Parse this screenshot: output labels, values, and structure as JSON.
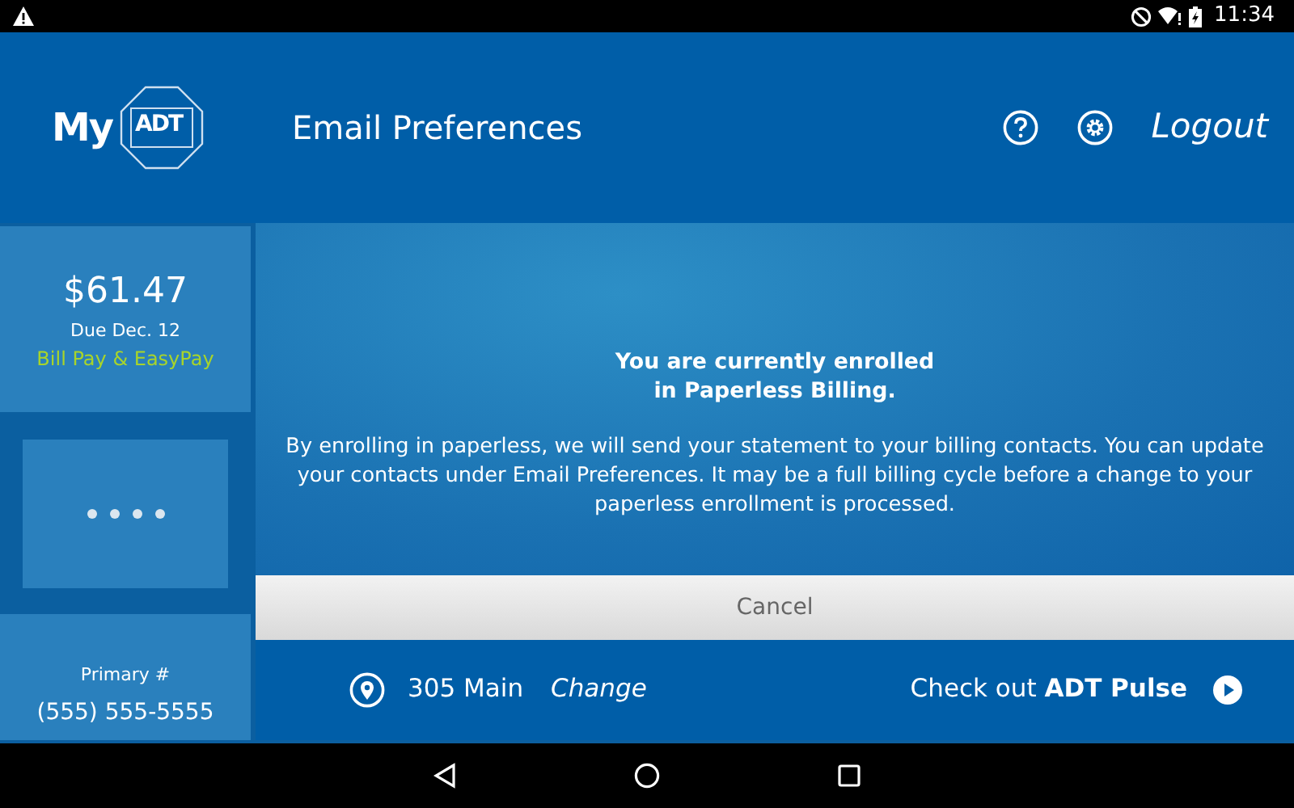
{
  "status_bar": {
    "time": "11:34"
  },
  "header": {
    "logo_prefix": "My",
    "logo_mark": "ADT",
    "title": "Email Preferences",
    "logout": "Logout"
  },
  "sidebar": {
    "bill": {
      "amount": "$61.47",
      "due": "Due Dec. 12",
      "link": "Bill Pay & EasyPay"
    },
    "contact": {
      "label": "Primary #",
      "phone": "(555) 555-5555"
    }
  },
  "dialog": {
    "heading": [
      "You are currently enrolled",
      "in Paperless Billing."
    ],
    "message": "By enrolling in paperless, we will send your statement to your billing contacts. You can update your contacts under Email Preferences. It may be a full billing cycle before a change to your paperless enrollment is processed.",
    "button": "Cancel"
  },
  "footer": {
    "address": "305 Main",
    "change": "Change",
    "promo": "Check out **ADT Pulse**"
  }
}
